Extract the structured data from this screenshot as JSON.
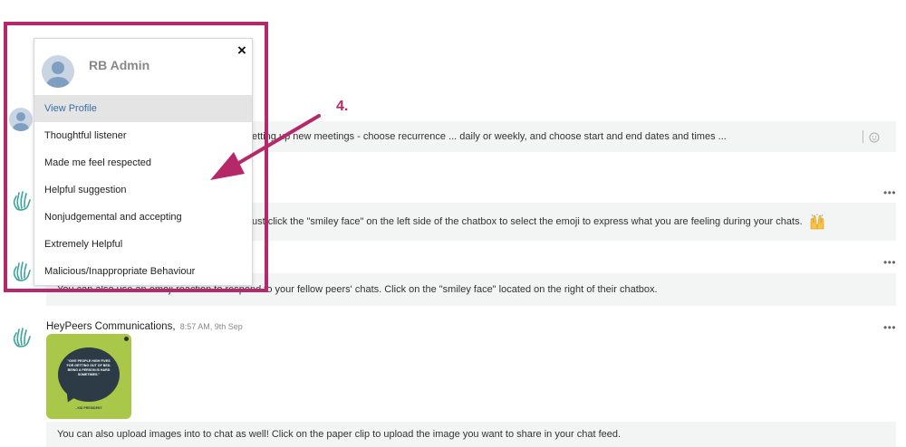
{
  "menu": {
    "user_name": "RB Admin",
    "close_symbol": "×",
    "items": [
      "View Profile",
      "Thoughtful listener",
      "Made me feel respected",
      "Helpful suggestion",
      "Nonjudgemental and accepting",
      "Extremely Helpful",
      "Malicious/Inappropriate Behaviour"
    ]
  },
  "annotation": {
    "step_label": "4.",
    "color": "#b5296a"
  },
  "feed": {
    "messages": [
      {
        "text": "etting up new meetings - choose recurrence ... daily or weekly, and choose start and end dates and times ..."
      },
      {
        "text": "ust click the \"smiley face\" on the left side of the chatbox to select the emoji to express what you are feeling during your chats."
      },
      {
        "text": "You can also use an emoji reaction to respond to your fellow peers' chats. Click on the \"smiley face\" located on the right of their chatbox."
      },
      {
        "text": "You can also upload images into to chat as well! Click on the paper clip to upload the image you want to share in your chat feed."
      }
    ],
    "sender": {
      "name": "HeyPeers Communications,",
      "time": "8:57 AM, 9th Sep"
    },
    "more_symbol": "•••",
    "image_card": {
      "quote": "\"GIVE PEOPLE HIGH FIVES FOR GETTING OUT OF BED. BEING A PERSON IS HARD SOMETIMES.\"",
      "author": "- KID PRESIDENT",
      "bg_color": "#a9c84a"
    }
  },
  "icons": {
    "wave": "waving-hand-icon",
    "smiley": "smiley-icon",
    "close": "close-icon",
    "avatar": "avatar",
    "raised_hands": "raised-hands-emoji"
  }
}
